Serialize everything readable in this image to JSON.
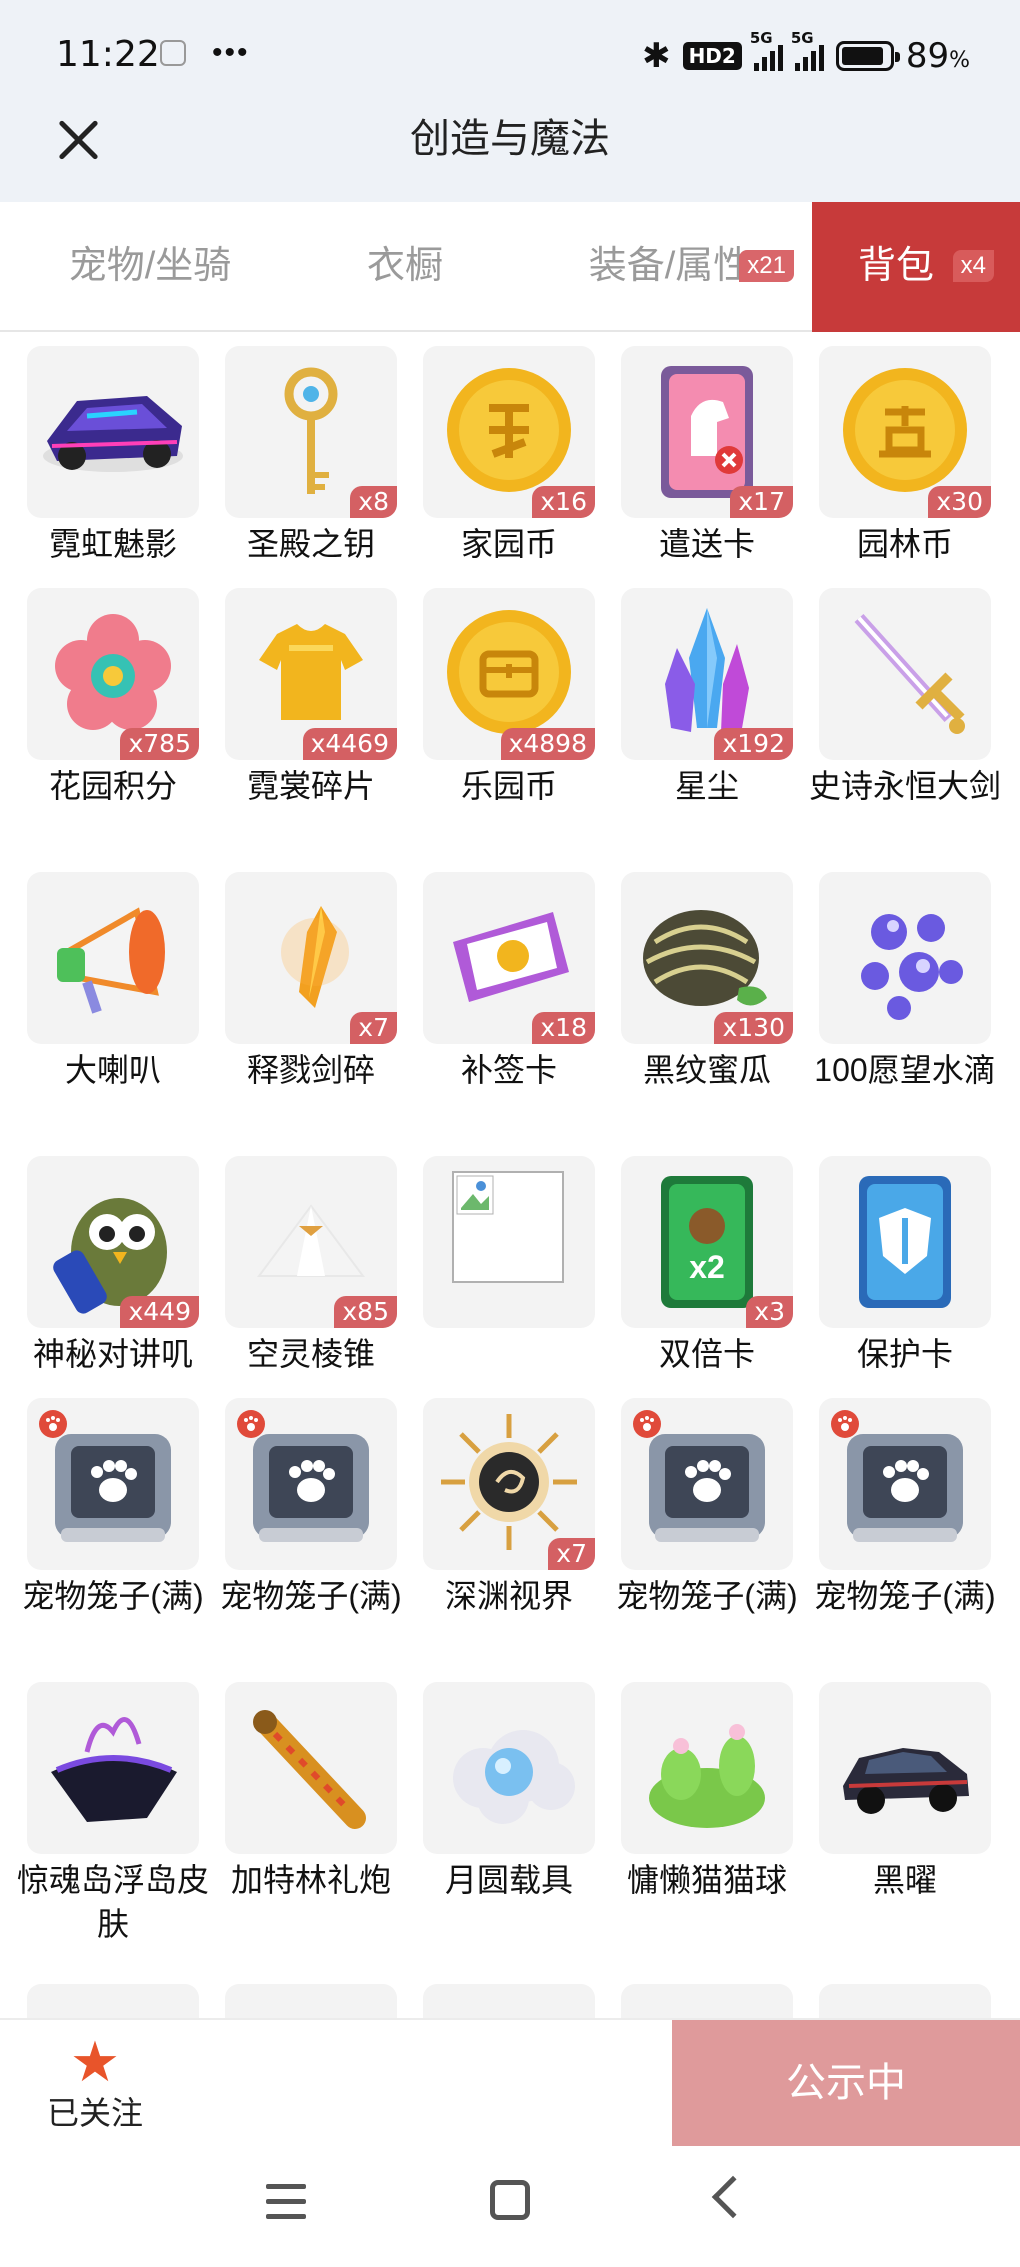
{
  "status_bar": {
    "time": "11:22",
    "dots": "•••",
    "hd_label": "HD2",
    "signal1_label": "5G",
    "signal2_label": "5G",
    "battery_text": "89",
    "battery_unit": "%",
    "battery_level": 0.89
  },
  "header": {
    "title": "创造与魔法",
    "close_icon": "close-icon"
  },
  "tabs": [
    {
      "label": "宠物/坐骑",
      "badge": ""
    },
    {
      "label": "衣橱",
      "badge": ""
    },
    {
      "label": "装备/属性",
      "badge": "x21"
    },
    {
      "label": "背包",
      "badge": "x4",
      "active": true
    }
  ],
  "items": [
    {
      "name": "霓虹魅影",
      "qty": "",
      "icon": "neon-car-icon"
    },
    {
      "name": "圣殿之钥",
      "qty": "x8",
      "icon": "golden-key-icon"
    },
    {
      "name": "家园币",
      "qty": "x16",
      "icon": "home-coin-icon"
    },
    {
      "name": "遣送卡",
      "qty": "x17",
      "icon": "horse-card-icon"
    },
    {
      "name": "园林币",
      "qty": "x30",
      "icon": "garden-coin-icon"
    },
    {
      "name": "花园积分",
      "qty": "x785",
      "icon": "flower-badge-icon"
    },
    {
      "name": "霓裳碎片",
      "qty": "x4469",
      "icon": "shirt-icon"
    },
    {
      "name": "乐园币",
      "qty": "x4898",
      "icon": "chest-coin-icon"
    },
    {
      "name": "星尘",
      "qty": "x192",
      "icon": "crystal-icon"
    },
    {
      "name": "史诗永恒大剑",
      "qty": "",
      "icon": "sword-icon"
    },
    {
      "name": "大喇叭",
      "qty": "",
      "icon": "megaphone-icon"
    },
    {
      "name": "释戮剑碎",
      "qty": "x7",
      "icon": "sword-shard-icon"
    },
    {
      "name": "补签卡",
      "qty": "x18",
      "icon": "ticket-icon"
    },
    {
      "name": "黑纹蜜瓜",
      "qty": "x130",
      "icon": "melon-icon"
    },
    {
      "name": "100愿望水滴",
      "qty": "",
      "icon": "water-drops-icon"
    },
    {
      "name": "神秘对讲叽",
      "qty": "x449",
      "icon": "walkie-bird-icon"
    },
    {
      "name": "空灵棱锥",
      "qty": "x85",
      "icon": "pyramid-icon"
    },
    {
      "name": "",
      "qty": "",
      "icon": "broken-image-icon"
    },
    {
      "name": "双倍卡",
      "qty": "x3",
      "icon": "double-card-icon"
    },
    {
      "name": "保护卡",
      "qty": "",
      "icon": "shield-card-icon"
    },
    {
      "name": "宠物笼子(满)",
      "qty": "",
      "icon": "pet-cage-icon"
    },
    {
      "name": "宠物笼子(满)",
      "qty": "",
      "icon": "pet-cage-icon"
    },
    {
      "name": "深渊视界",
      "qty": "x7",
      "icon": "abyss-eye-icon"
    },
    {
      "name": "宠物笼子(满)",
      "qty": "",
      "icon": "pet-cage-icon"
    },
    {
      "name": "宠物笼子(满)",
      "qty": "",
      "icon": "pet-cage-icon"
    },
    {
      "name": "惊魂岛浮岛皮肤",
      "qty": "",
      "icon": "floating-island-icon"
    },
    {
      "name": "加特林礼炮",
      "qty": "",
      "icon": "cannon-icon"
    },
    {
      "name": "月圆载具",
      "qty": "",
      "icon": "moon-cloud-icon"
    },
    {
      "name": "慵懒猫猫球",
      "qty": "",
      "icon": "cactus-cat-icon"
    },
    {
      "name": "黑曜",
      "qty": "",
      "icon": "black-car-icon"
    }
  ],
  "bottom": {
    "follow_label": "已关注",
    "public_label": "公示中"
  },
  "colors": {
    "accent_red": "#c73a3a",
    "badge_red": "#d46063",
    "public_btn": "#df9a9b",
    "star": "#e8542a"
  }
}
